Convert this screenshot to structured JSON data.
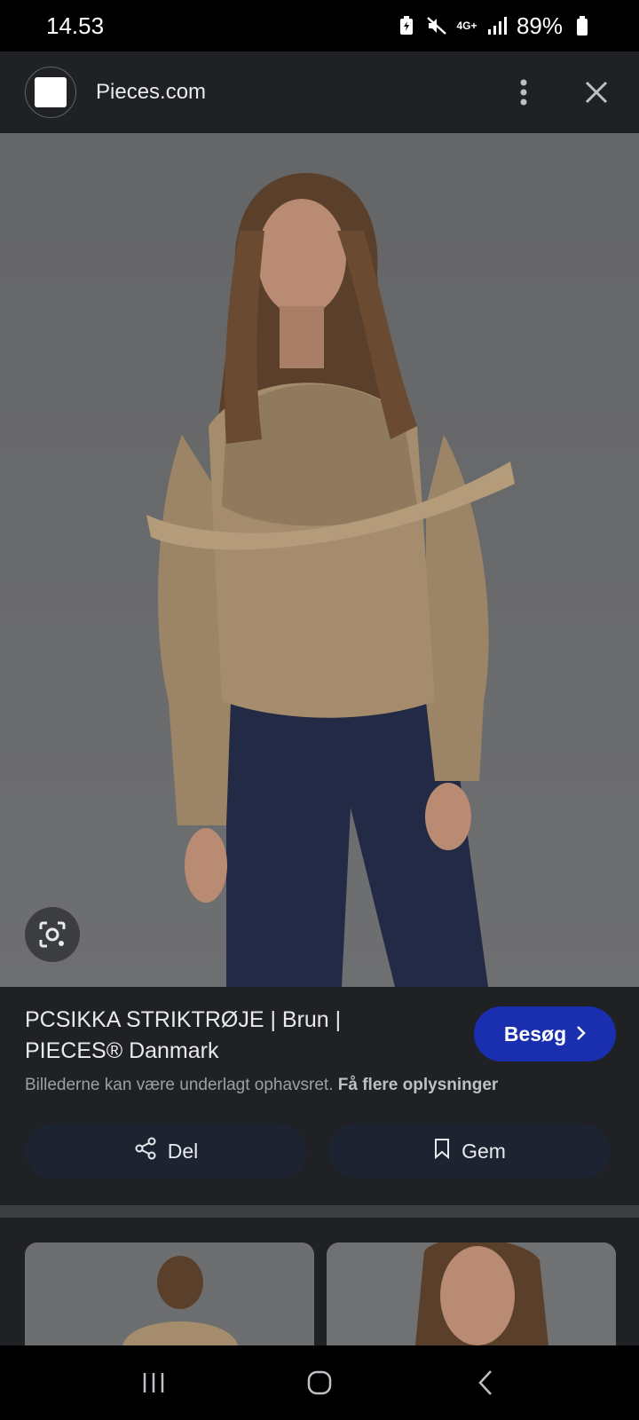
{
  "status_bar": {
    "time": "14.53",
    "network": "4G+",
    "battery": "89%"
  },
  "header": {
    "site_name": "Pieces.com"
  },
  "result": {
    "title": "PCSIKKA STRIKTRØJE | Brun | PIECES® Danmark",
    "visit_label": "Besøg",
    "copyright_text": "Billederne kan være underlagt ophavsret.",
    "more_info_label": "Få flere oplysninger",
    "share_label": "Del",
    "save_label": "Gem"
  },
  "colors": {
    "background": "#202124",
    "visit_button": "#1a2fb0",
    "action_button": "#1d2330",
    "sweater": "#a48c6d",
    "jeans": "#232a45"
  },
  "icons": {
    "lens": "lens-icon",
    "share": "share-icon",
    "save": "bookmark-icon",
    "more": "more-vert-icon",
    "close": "close-icon"
  }
}
